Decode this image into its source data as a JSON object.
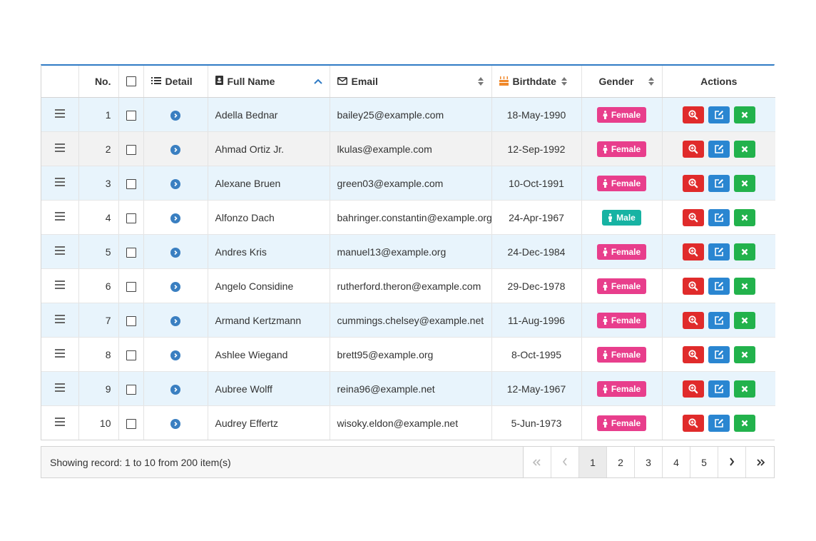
{
  "colors": {
    "accent": "#2f7bc5",
    "female": "#e83e8c",
    "male": "#17b3a3",
    "view": "#e02b2b",
    "edit": "#2a86d1",
    "delete": "#22b24c"
  },
  "header": {
    "no": "No.",
    "detail": "Detail",
    "full_name": "Full Name",
    "email": "Email",
    "birthdate": "Birthdate",
    "gender": "Gender",
    "actions": "Actions"
  },
  "rows": [
    {
      "no": "1",
      "name": "Adella Bednar",
      "email": "bailey25@example.com",
      "birthdate": "18-May-1990",
      "gender": "Female"
    },
    {
      "no": "2",
      "name": "Ahmad Ortiz Jr.",
      "email": "lkulas@example.com",
      "birthdate": "12-Sep-1992",
      "gender": "Female"
    },
    {
      "no": "3",
      "name": "Alexane Bruen",
      "email": "green03@example.com",
      "birthdate": "10-Oct-1991",
      "gender": "Female"
    },
    {
      "no": "4",
      "name": "Alfonzo Dach",
      "email": "bahringer.constantin@example.org",
      "birthdate": "24-Apr-1967",
      "gender": "Male"
    },
    {
      "no": "5",
      "name": "Andres Kris",
      "email": "manuel13@example.org",
      "birthdate": "24-Dec-1984",
      "gender": "Female"
    },
    {
      "no": "6",
      "name": "Angelo Considine",
      "email": "rutherford.theron@example.com",
      "birthdate": "29-Dec-1978",
      "gender": "Female"
    },
    {
      "no": "7",
      "name": "Armand Kertzmann",
      "email": "cummings.chelsey@example.net",
      "birthdate": "11-Aug-1996",
      "gender": "Female"
    },
    {
      "no": "8",
      "name": "Ashlee Wiegand",
      "email": "brett95@example.org",
      "birthdate": "8-Oct-1995",
      "gender": "Female"
    },
    {
      "no": "9",
      "name": "Aubree Wolff",
      "email": "reina96@example.net",
      "birthdate": "12-May-1967",
      "gender": "Female"
    },
    {
      "no": "10",
      "name": "Audrey Effertz",
      "email": "wisoky.eldon@example.net",
      "birthdate": "5-Jun-1973",
      "gender": "Female"
    }
  ],
  "footer": {
    "info": "Showing record: 1 to 10 from 200 item(s)",
    "pages": [
      "1",
      "2",
      "3",
      "4",
      "5"
    ],
    "current_page": "1"
  }
}
